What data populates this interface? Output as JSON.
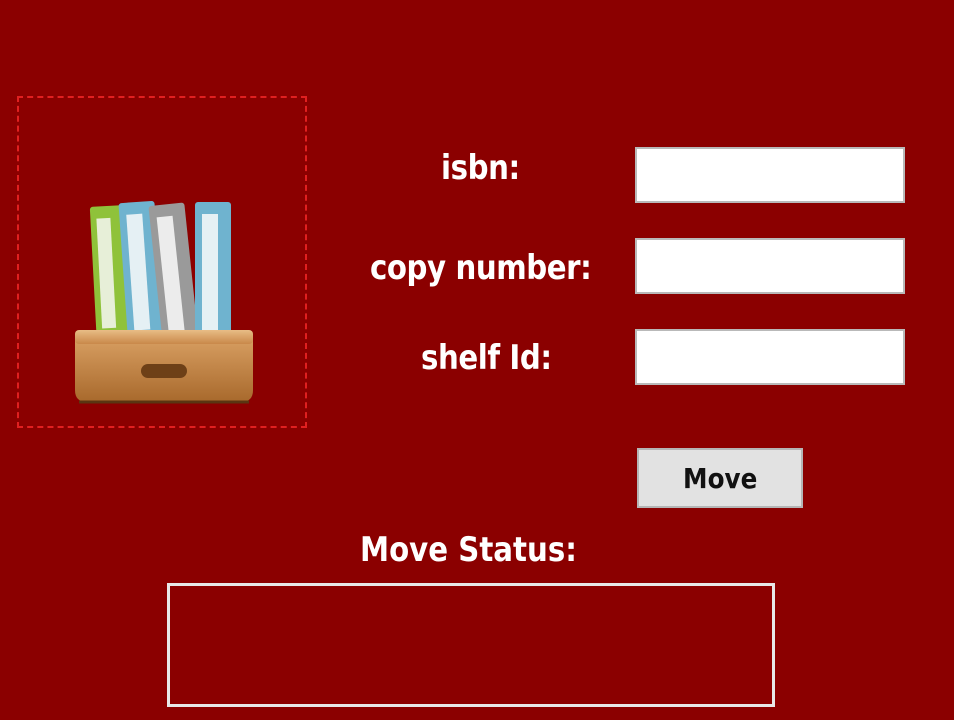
{
  "form": {
    "isbn_label": "isbn:",
    "isbn_value": "",
    "copy_number_label": "copy number:",
    "copy_number_value": "",
    "shelf_id_label": "shelf Id:",
    "shelf_id_value": "",
    "move_button_label": "Move",
    "status_label": "Move Status:",
    "status_text": ""
  },
  "icon": {
    "image": "binders-in-wooden-tray-icon"
  },
  "colors": {
    "background": "#8b0000",
    "frame_border": "#e02020",
    "label_text": "#ffffff",
    "button_bg": "#e2e2e2"
  }
}
